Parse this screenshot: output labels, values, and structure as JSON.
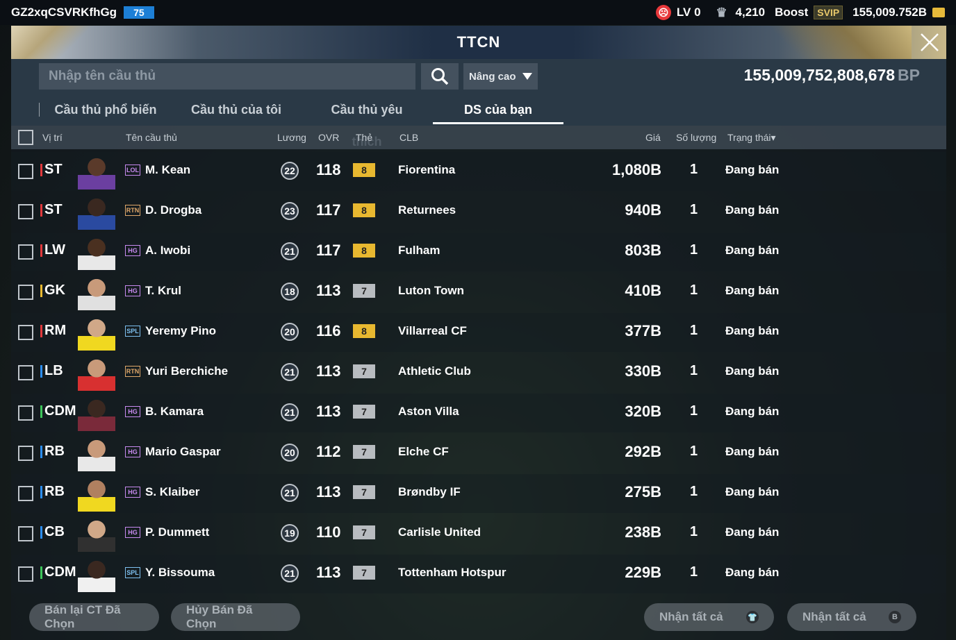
{
  "topbar": {
    "username": "GZ2xqCSVRKfhGg",
    "level_badge": "75",
    "lv_label": "LV 0",
    "trophy_value": "4,210",
    "boost_label": "Boost",
    "svip_label": "SVIP",
    "balance": "155,009.752B"
  },
  "header": {
    "title": "TTCN"
  },
  "search": {
    "placeholder": "Nhập tên cầu thủ",
    "advanced_label": "Nâng cao",
    "bp_amount": "155,009,752,808,678",
    "bp_unit": "BP"
  },
  "tabs": [
    {
      "label": "Cầu thủ phổ biến"
    },
    {
      "label": "Cầu thủ của tôi"
    },
    {
      "label": "Cầu thủ yêu thích"
    },
    {
      "label": "DS của bạn"
    }
  ],
  "columns": {
    "position": "Vị trí",
    "name": "Tên cầu thủ",
    "wage": "Lương",
    "ovr": "OVR",
    "card": "Thẻ",
    "club": "CLB",
    "price": "Giá",
    "qty": "Số lượng",
    "status": "Trạng thái▾"
  },
  "rows": [
    {
      "pos": "ST",
      "season": "LOL",
      "name": "M. Kean",
      "wage": "22",
      "ovr": "118",
      "grade": "8",
      "club": "Fiorentina",
      "price": "1,080B",
      "qty": "1",
      "status": "Đang bán"
    },
    {
      "pos": "ST",
      "season": "RTN",
      "name": "D. Drogba",
      "wage": "23",
      "ovr": "117",
      "grade": "8",
      "club": "Returnees",
      "price": "940B",
      "qty": "1",
      "status": "Đang bán"
    },
    {
      "pos": "LW",
      "season": "HG",
      "name": "A. Iwobi",
      "wage": "21",
      "ovr": "117",
      "grade": "8",
      "club": "Fulham",
      "price": "803B",
      "qty": "1",
      "status": "Đang bán"
    },
    {
      "pos": "GK",
      "season": "HG",
      "name": "T. Krul",
      "wage": "18",
      "ovr": "113",
      "grade": "7",
      "club": "Luton Town",
      "price": "410B",
      "qty": "1",
      "status": "Đang bán"
    },
    {
      "pos": "RM",
      "season": "SPL",
      "name": "Yeremy Pino",
      "wage": "20",
      "ovr": "116",
      "grade": "8",
      "club": "Villarreal CF",
      "price": "377B",
      "qty": "1",
      "status": "Đang bán"
    },
    {
      "pos": "LB",
      "season": "RTN",
      "name": "Yuri Berchiche",
      "wage": "21",
      "ovr": "113",
      "grade": "7",
      "club": "Athletic Club",
      "price": "330B",
      "qty": "1",
      "status": "Đang bán"
    },
    {
      "pos": "CDM",
      "season": "HG",
      "name": "B. Kamara",
      "wage": "21",
      "ovr": "113",
      "grade": "7",
      "club": "Aston Villa",
      "price": "320B",
      "qty": "1",
      "status": "Đang bán"
    },
    {
      "pos": "RB",
      "season": "HG",
      "name": "Mario Gaspar",
      "wage": "20",
      "ovr": "112",
      "grade": "7",
      "club": "Elche CF",
      "price": "292B",
      "qty": "1",
      "status": "Đang bán"
    },
    {
      "pos": "RB",
      "season": "HG",
      "name": "S. Klaiber",
      "wage": "21",
      "ovr": "113",
      "grade": "7",
      "club": "Brøndby IF",
      "price": "275B",
      "qty": "1",
      "status": "Đang bán"
    },
    {
      "pos": "CB",
      "season": "HG",
      "name": "P. Dummett",
      "wage": "19",
      "ovr": "110",
      "grade": "7",
      "club": "Carlisle United",
      "price": "238B",
      "qty": "1",
      "status": "Đang bán"
    },
    {
      "pos": "CDM",
      "season": "SPL",
      "name": "Y. Bissouma",
      "wage": "21",
      "ovr": "113",
      "grade": "7",
      "club": "Tottenham Hotspur",
      "price": "229B",
      "qty": "1",
      "status": "Đang bán"
    }
  ],
  "footer": {
    "resell_label": "Bán lại CT Đã Chọn",
    "cancel_label": "Hủy Bán Đã Chọn",
    "claim_all_1": "Nhận tất cả",
    "claim_all_2": "Nhận tất cả"
  },
  "colors": {
    "position": {
      "ST": "#e2383b",
      "LW": "#e2383b",
      "RM": "#e2383b",
      "GK": "#e8b830",
      "LB": "#2c8ef0",
      "RB": "#2c8ef0",
      "CB": "#2c8ef0",
      "CDM": "#3cc45a"
    },
    "season": {
      "LOL": "#c88af0",
      "RTN": "#e0a86a",
      "HG": "#c88af0",
      "SPL": "#7ec0f0"
    },
    "grade": {
      "8": "#e8b830",
      "7": "#b8bcc0"
    }
  }
}
